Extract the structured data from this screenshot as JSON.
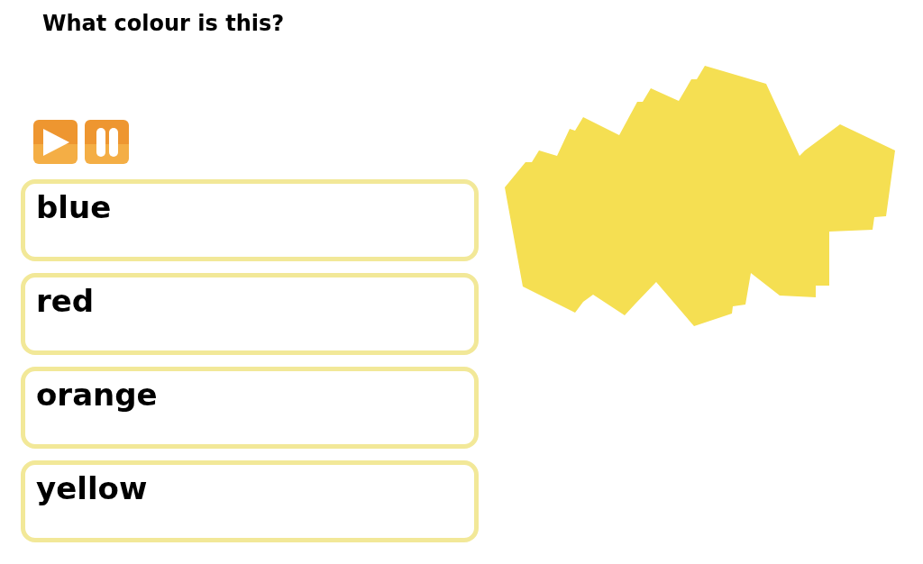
{
  "question": "What colour is this?",
  "audio_controls": [
    {
      "kind": "play"
    },
    {
      "kind": "pause"
    }
  ],
  "options": [
    {
      "label": "blue"
    },
    {
      "label": "red"
    },
    {
      "label": "orange"
    },
    {
      "label": "yellow"
    }
  ]
}
